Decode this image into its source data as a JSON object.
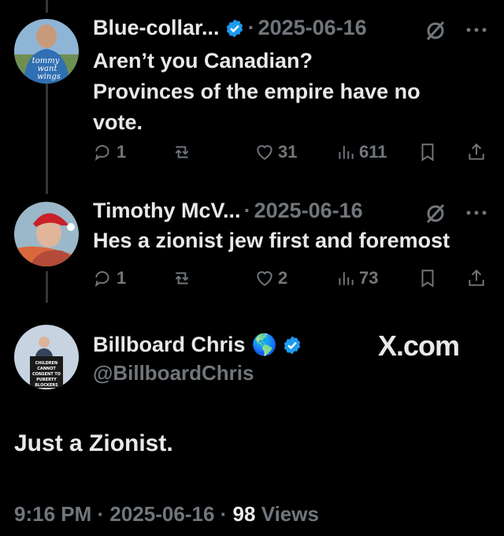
{
  "reply1": {
    "name": "Blue-collar...",
    "date": "2025-06-16",
    "separator": "·",
    "text_lines": [
      "Aren’t you Canadian?",
      "Provinces of the empire have no",
      "vote."
    ],
    "avatar_text": [
      "tommy",
      "want",
      "wings"
    ],
    "stats": {
      "replies": "1",
      "likes": "31",
      "views": "611"
    }
  },
  "reply2": {
    "name": "Timothy McV...",
    "date": "2025-06-16",
    "separator": "·",
    "text": "Hes a zionist jew first and foremost",
    "stats": {
      "replies": "1",
      "likes": "2",
      "views": "73"
    }
  },
  "main": {
    "name": "Billboard Chris",
    "emoji": "🌎",
    "handle": "@BillboardChris",
    "watermark": "X.com",
    "sign_text": [
      "CHILDREN",
      "CANNOT",
      "CONSENT TO",
      "PUBERTY",
      "BLOCKERS"
    ],
    "text": "Just a Zionist.",
    "time": "9:16 PM",
    "date": "2025-06-16",
    "separator": "·",
    "views_count": "98",
    "views_label": "Views"
  },
  "colors": {
    "background": "#000000",
    "text": "#e7e9ea",
    "muted": "#71767b",
    "verified": "#1d9bf0"
  }
}
